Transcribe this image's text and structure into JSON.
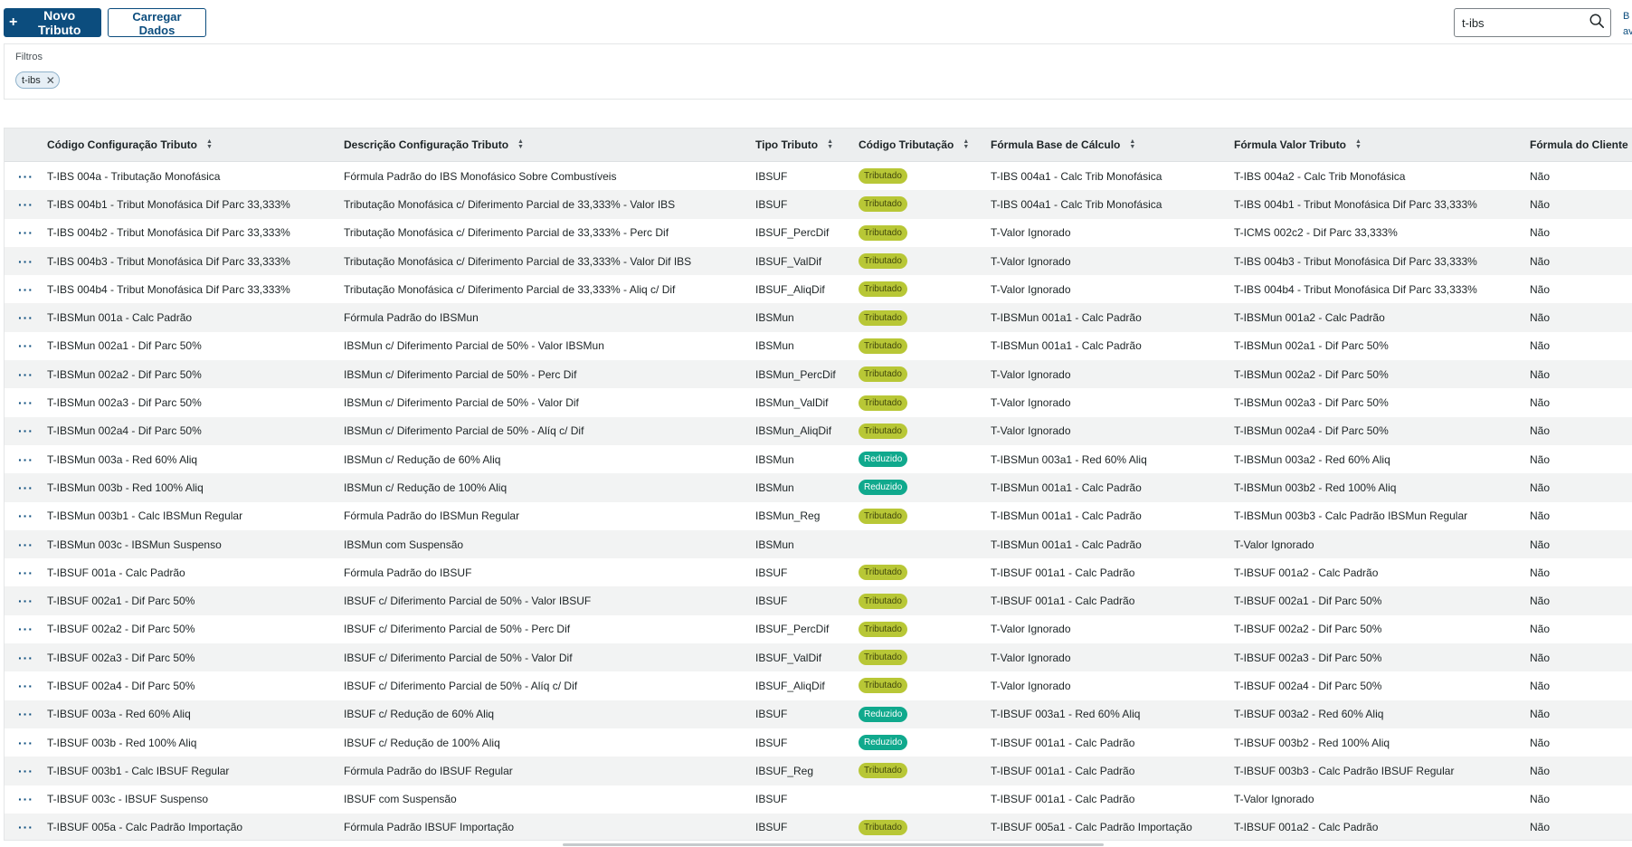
{
  "toolbar": {
    "new_label": "Novo Tributo",
    "load_label": "Carregar Dados",
    "search_value": "t-ibs",
    "edge_link": "B\nav"
  },
  "filters": {
    "title": "Filtros",
    "chips": [
      "t-ibs"
    ]
  },
  "table": {
    "columns": [
      "Código Configuração Tributo",
      "Descrição Configuração Tributo",
      "Tipo Tributo",
      "Código Tributação",
      "Fórmula Base de Cálculo",
      "Fórmula Valor Tributo",
      "Fórmula do Cliente"
    ],
    "rows": [
      [
        "T-IBS 004a - Tributação Monofásica",
        "Fórmula Padrão do IBS Monofásico Sobre Combustíveis",
        "IBSUF",
        "Tributado",
        "T-IBS 004a1 - Calc Trib Monofásica",
        "T-IBS 004a2 - Calc Trib Monofásica",
        "Não"
      ],
      [
        "T-IBS 004b1 - Tribut Monofásica Dif Parc 33,333%",
        "Tributação Monofásica c/ Diferimento Parcial de 33,333% - Valor IBS",
        "IBSUF",
        "Tributado",
        "T-IBS 004a1 - Calc Trib Monofásica",
        "T-IBS 004b1 - Tribut Monofásica Dif Parc 33,333%",
        "Não"
      ],
      [
        "T-IBS 004b2 - Tribut Monofásica Dif Parc 33,333%",
        "Tributação Monofásica c/ Diferimento Parcial de 33,333% - Perc Dif",
        "IBSUF_PercDif",
        "Tributado",
        "T-Valor Ignorado",
        "T-ICMS 002c2 - Dif Parc 33,333%",
        "Não"
      ],
      [
        "T-IBS 004b3 - Tribut Monofásica Dif Parc 33,333%",
        "Tributação Monofásica c/ Diferimento Parcial de 33,333% - Valor Dif IBS",
        "IBSUF_ValDif",
        "Tributado",
        "T-Valor Ignorado",
        "T-IBS 004b3 - Tribut Monofásica Dif Parc 33,333%",
        "Não"
      ],
      [
        "T-IBS 004b4 - Tribut Monofásica Dif Parc 33,333%",
        "Tributação Monofásica c/ Diferimento Parcial de 33,333% - Aliq c/ Dif",
        "IBSUF_AliqDif",
        "Tributado",
        "T-Valor Ignorado",
        "T-IBS 004b4 - Tribut Monofásica Dif Parc 33,333%",
        "Não"
      ],
      [
        "T-IBSMun 001a - Calc Padrão",
        "Fórmula Padrão do IBSMun",
        "IBSMun",
        "Tributado",
        "T-IBSMun 001a1 - Calc Padrão",
        "T-IBSMun 001a2 - Calc Padrão",
        "Não"
      ],
      [
        "T-IBSMun 002a1 - Dif Parc 50%",
        "IBSMun c/ Diferimento Parcial de 50% - Valor IBSMun",
        "IBSMun",
        "Tributado",
        "T-IBSMun 001a1 - Calc Padrão",
        "T-IBSMun 002a1 - Dif Parc 50%",
        "Não"
      ],
      [
        "T-IBSMun 002a2 - Dif Parc 50%",
        "IBSMun c/ Diferimento Parcial de 50% - Perc Dif",
        "IBSMun_PercDif",
        "Tributado",
        "T-Valor Ignorado",
        "T-IBSMun 002a2 - Dif Parc 50%",
        "Não"
      ],
      [
        "T-IBSMun 002a3 - Dif Parc 50%",
        "IBSMun c/ Diferimento Parcial de 50% - Valor Dif",
        "IBSMun_ValDif",
        "Tributado",
        "T-Valor Ignorado",
        "T-IBSMun 002a3 - Dif Parc 50%",
        "Não"
      ],
      [
        "T-IBSMun 002a4 - Dif Parc 50%",
        "IBSMun c/ Diferimento Parcial de 50% - Alíq c/ Dif",
        "IBSMun_AliqDif",
        "Tributado",
        "T-Valor Ignorado",
        "T-IBSMun 002a4 - Dif Parc 50%",
        "Não"
      ],
      [
        "T-IBSMun 003a - Red 60% Aliq",
        "IBSMun c/ Redução de 60% Aliq",
        "IBSMun",
        "Reduzido",
        "T-IBSMun 003a1 - Red 60% Aliq",
        "T-IBSMun 003a2 - Red 60% Aliq",
        "Não"
      ],
      [
        "T-IBSMun 003b - Red 100% Aliq",
        "IBSMun c/ Redução de 100% Aliq",
        "IBSMun",
        "Reduzido",
        "T-IBSMun 001a1 - Calc Padrão",
        "T-IBSMun 003b2 - Red 100% Aliq",
        "Não"
      ],
      [
        "T-IBSMun 003b1 - Calc IBSMun Regular",
        "Fórmula Padrão do IBSMun Regular",
        "IBSMun_Reg",
        "Tributado",
        "T-IBSMun 001a1 - Calc Padrão",
        "T-IBSMun 003b3 - Calc Padrão IBSMun Regular",
        "Não"
      ],
      [
        "T-IBSMun 003c - IBSMun Suspenso",
        "IBSMun com Suspensão",
        "IBSMun",
        "",
        "T-IBSMun 001a1 - Calc Padrão",
        "T-Valor Ignorado",
        "Não"
      ],
      [
        "T-IBSUF 001a - Calc Padrão",
        "Fórmula Padrão do IBSUF",
        "IBSUF",
        "Tributado",
        "T-IBSUF 001a1 - Calc Padrão",
        "T-IBSUF 001a2 - Calc Padrão",
        "Não"
      ],
      [
        "T-IBSUF 002a1 - Dif Parc 50%",
        "IBSUF c/ Diferimento Parcial de 50% - Valor IBSUF",
        "IBSUF",
        "Tributado",
        "T-IBSUF 001a1 - Calc Padrão",
        "T-IBSUF 002a1 - Dif Parc 50%",
        "Não"
      ],
      [
        "T-IBSUF 002a2 - Dif Parc 50%",
        "IBSUF c/ Diferimento Parcial de 50% - Perc Dif",
        "IBSUF_PercDif",
        "Tributado",
        "T-Valor Ignorado",
        "T-IBSUF 002a2 - Dif Parc 50%",
        "Não"
      ],
      [
        "T-IBSUF 002a3 - Dif Parc 50%",
        "IBSUF c/ Diferimento Parcial de 50% - Valor Dif",
        "IBSUF_ValDif",
        "Tributado",
        "T-Valor Ignorado",
        "T-IBSUF 002a3 - Dif Parc 50%",
        "Não"
      ],
      [
        "T-IBSUF 002a4 - Dif Parc 50%",
        "IBSUF c/ Diferimento Parcial de 50% - Alíq c/ Dif",
        "IBSUF_AliqDif",
        "Tributado",
        "T-Valor Ignorado",
        "T-IBSUF 002a4 - Dif Parc 50%",
        "Não"
      ],
      [
        "T-IBSUF 003a - Red 60% Aliq",
        "IBSUF c/ Redução de 60% Aliq",
        "IBSUF",
        "Reduzido",
        "T-IBSUF 003a1 - Red 60% Aliq",
        "T-IBSUF 003a2 - Red 60% Aliq",
        "Não"
      ],
      [
        "T-IBSUF 003b - Red 100% Aliq",
        "IBSUF c/ Redução de 100% Aliq",
        "IBSUF",
        "Reduzido",
        "T-IBSUF 001a1 - Calc Padrão",
        "T-IBSUF 003b2 - Red 100% Aliq",
        "Não"
      ],
      [
        "T-IBSUF 003b1 - Calc IBSUF Regular",
        "Fórmula Padrão do IBSUF Regular",
        "IBSUF_Reg",
        "Tributado",
        "T-IBSUF 001a1 - Calc Padrão",
        "T-IBSUF 003b3 - Calc Padrão IBSUF Regular",
        "Não"
      ],
      [
        "T-IBSUF 003c - IBSUF Suspenso",
        "IBSUF com Suspensão",
        "IBSUF",
        "",
        "T-IBSUF 001a1 - Calc Padrão",
        "T-Valor Ignorado",
        "Não"
      ],
      [
        "T-IBSUF 005a - Calc Padrão Importação",
        "Fórmula Padrão IBSUF Importação",
        "IBSUF",
        "Tributado",
        "T-IBSUF 005a1 - Calc Padrão Importação",
        "T-IBSUF 001a2 - Calc Padrão",
        "Não"
      ]
    ]
  },
  "colors": {
    "primary": "#0c4d7e",
    "badge_tributado": "#b8c736",
    "badge_reduzido": "#10a98d"
  },
  "icons": {
    "add": "plus-icon",
    "search": "search-icon",
    "remove_chip": "close-icon",
    "sort": "sort-icon",
    "row_actions": "more-horizontal-icon"
  }
}
